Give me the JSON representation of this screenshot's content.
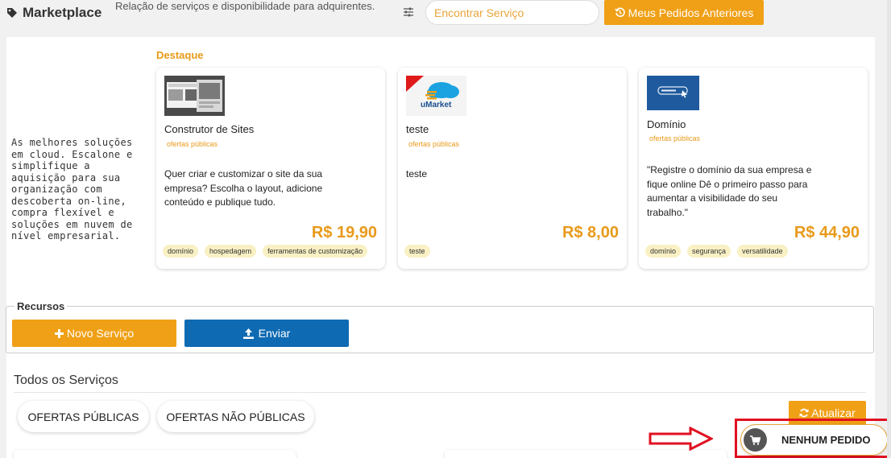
{
  "header": {
    "title": "Marketplace",
    "subtitle": "Relação de serviços e disponibilidade para adquirentes.",
    "search_placeholder": "Encontrar Serviço",
    "history_button": "Meus Pedidos Anteriores"
  },
  "intro": {
    "text": "As melhores soluções em cloud. Escalone e simplifique a aquisição para sua organização com descoberta on-line, compra flexível e soluções em nuvem de nível empresarial."
  },
  "featured": {
    "label": "Destaque",
    "cards": [
      {
        "name": "Construtor de Sites",
        "tag": "ofertas públicas",
        "description": "Quer criar e customizar o site da sua empresa? Escolha o layout, adicione conteúdo e publique tudo.",
        "price": "R$ 19,90",
        "chips": [
          "domínio",
          "hospedagem",
          "ferramentas de customização"
        ],
        "thumb_icon": "website-builder-thumbnail"
      },
      {
        "name": "teste",
        "tag": "ofertas públicas",
        "description": "teste",
        "price": "R$ 8,00",
        "chips": [
          "teste"
        ],
        "thumb_icon": "umarket-cloud-logo",
        "thumb_text": "uMarket"
      },
      {
        "name": "Domínio",
        "tag": "ofertas públicas",
        "description": "\"Registre o domínio da sua empresa e fique online Dê o primeiro passo para aumentar a visibilidade do seu trabalho.\"",
        "price": "R$ 44,90",
        "chips": [
          "domínio",
          "segurança",
          "versatilidade"
        ],
        "thumb_icon": "domain-thumbnail"
      }
    ]
  },
  "resources": {
    "legend": "Recursos",
    "new_service": "Novo Serviço",
    "send": "Enviar"
  },
  "services": {
    "title": "Todos os Serviços",
    "tab_public": "OFERTAS PÚBLICAS",
    "tab_private": "OFERTAS NÃO PÚBLICAS",
    "refresh": "Atualizar"
  },
  "cart": {
    "label": "NENHUM PEDIDO"
  },
  "colors": {
    "accent": "#f0a016",
    "primary_blue": "#0e6ab3",
    "highlight_red": "#e01020"
  }
}
